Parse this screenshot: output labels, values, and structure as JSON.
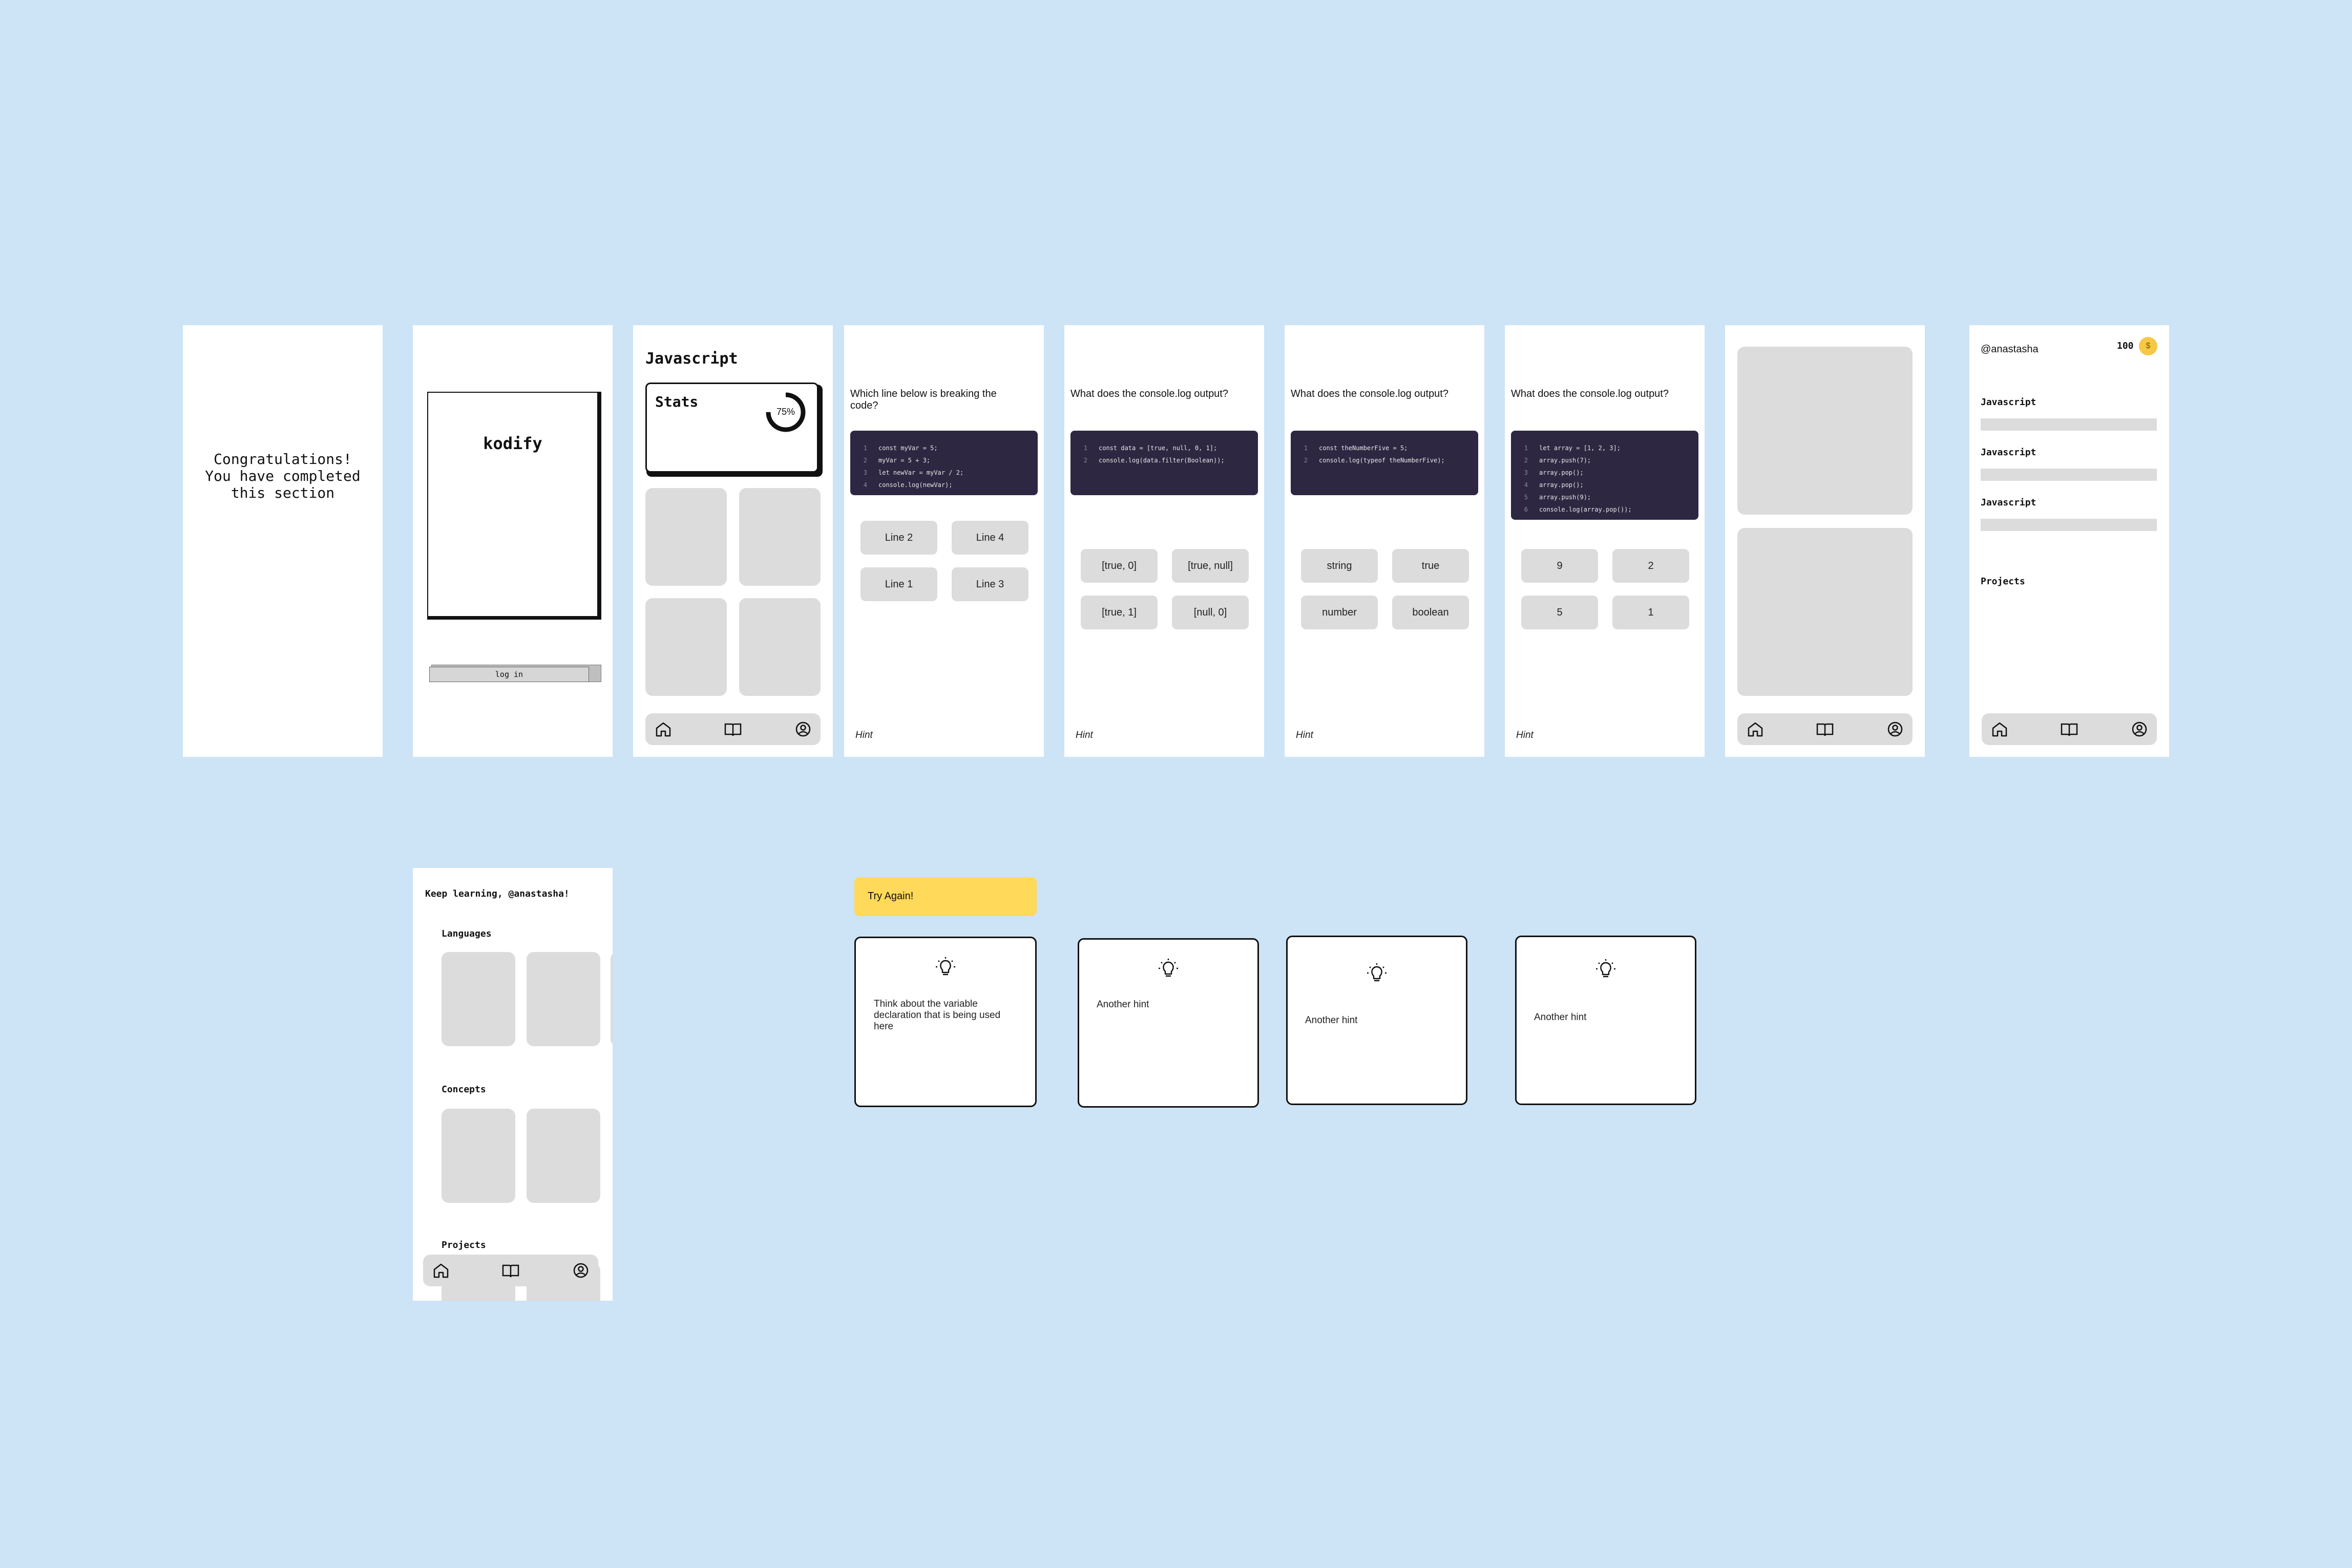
{
  "congrats": {
    "message": "Congratulations! You have completed this section"
  },
  "login": {
    "logo": "kodify",
    "login_button": "log in"
  },
  "dashboard": {
    "title": "Javascript",
    "stats_label": "Stats",
    "progress_percent": 75,
    "progress_label": "75%"
  },
  "quiz1": {
    "question": "Which line below is breaking the code?",
    "hint": "Hint",
    "code": [
      [
        "1",
        "const myVar = 5;"
      ],
      [
        "2",
        "myVar = 5 + 3;"
      ],
      [
        "3",
        "let newVar = myVar / 2;"
      ],
      [
        "4",
        "console.log(newVar);"
      ]
    ],
    "options": [
      "Line 2",
      "Line 4",
      "Line 1",
      "Line 3"
    ]
  },
  "quiz2": {
    "question": "What does the console.log output?",
    "hint": "Hint",
    "code": [
      [
        "1",
        "const data = [true, null, 0, 1];"
      ],
      [
        "2",
        "console.log(data.filter(Boolean));"
      ]
    ],
    "options": [
      "[true, 0]",
      "[true, null]",
      "[true, 1]",
      "[null, 0]"
    ]
  },
  "quiz3": {
    "question": "What does the console.log output?",
    "hint": "Hint",
    "code": [
      [
        "1",
        "const theNumberFive = 5;"
      ],
      [
        "2",
        "console.log(typeof theNumberFive);"
      ]
    ],
    "options": [
      "string",
      "true",
      "number",
      "boolean"
    ]
  },
  "quiz4": {
    "question": "What does the console.log output?",
    "hint": "Hint",
    "code": [
      [
        "1",
        "let array = [1, 2, 3];"
      ],
      [
        "2",
        "array.push(7);"
      ],
      [
        "3",
        "array.pop();"
      ],
      [
        "4",
        "array.pop();"
      ],
      [
        "5",
        "array.push(9);"
      ],
      [
        "6",
        "console.log(array.pop());"
      ]
    ],
    "options": [
      "9",
      "2",
      "5",
      "1"
    ]
  },
  "profile": {
    "username": "@anastasha",
    "coins": "100",
    "coin_symbol": "$",
    "courses": [
      "Javascript",
      "Javascript",
      "Javascript"
    ],
    "projects_label": "Projects"
  },
  "home": {
    "greeting": "Keep learning, @anastasha!",
    "languages_label": "Languages",
    "concepts_label": "Concepts",
    "projects_label": "Projects"
  },
  "feedback": {
    "try_again": "Try Again!"
  },
  "hints": [
    "Think about the variable declaration that is being used here",
    "Another hint",
    "Another hint",
    "Another hint"
  ],
  "colors": {
    "background": "#cde3f6",
    "code_bg": "#2e2742",
    "placeholder": "#dcdcdc",
    "alert": "#ffd95a",
    "coin": "#f7c843"
  }
}
